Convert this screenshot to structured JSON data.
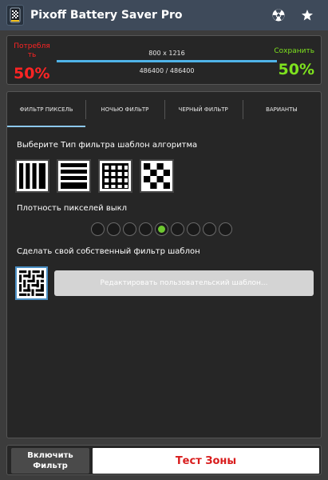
{
  "app": {
    "title": "Pixoff Battery Saver Pro",
    "logo_icon": "pixel-phone-logo-icon",
    "actions": [
      {
        "name": "radiation-icon"
      },
      {
        "name": "star-icon"
      }
    ]
  },
  "status": {
    "consume_label": "Потребля ть",
    "consume_value": "50%",
    "resolution": "800 x 1216",
    "pixels": "486400 / 486400",
    "progress_fraction": 1.0,
    "save_label": "Сохранить",
    "save_value": "50%",
    "colors": {
      "consume": "#ff2424",
      "save": "#7ee21e",
      "progress": "#4fb3e8"
    }
  },
  "tabs": [
    {
      "label": "ФИЛЬТР ПИКСЕЛЬ",
      "active": true
    },
    {
      "label": "НОЧЬЮ ФИЛЬТР",
      "active": false
    },
    {
      "label": "ЧЕРНЫЙ ФИЛЬТР",
      "active": false
    },
    {
      "label": "ВАРИАНТЫ",
      "active": false
    }
  ],
  "filter": {
    "pattern_title": "Выберите Тип фильтра шаблон алгоритма",
    "patterns": [
      {
        "name": "vertical-lines",
        "selected": false
      },
      {
        "name": "horizontal-lines",
        "selected": false
      },
      {
        "name": "grid",
        "selected": false
      },
      {
        "name": "checker",
        "selected": false
      }
    ],
    "density_title": "Плотность пикселей выкл",
    "density_levels": 9,
    "density_selected": 5,
    "custom_title": "Сделать свой собственный фильтр шаблон",
    "edit_button": "Редактировать пользовательский шаблон..."
  },
  "bottom": {
    "enable_label_line1": "Включить",
    "enable_label_line2": "Фильтр",
    "test_label": "Тест Зоны"
  }
}
